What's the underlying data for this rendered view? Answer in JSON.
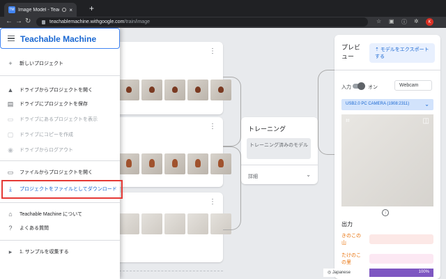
{
  "browser": {
    "tab_title": "Image Model - Teachable M",
    "tab_icon_text": "TM",
    "close_glyph": "×",
    "newtab_glyph": "+",
    "url_host": "teachablemachine.withgoogle.com",
    "url_path": "/train/image",
    "profile_initial": "K"
  },
  "drawer": {
    "brand": "Teachable Machine",
    "items": [
      {
        "label": "新しいプロジェクト",
        "icon": "plus-icon"
      },
      {
        "label": "ドライブからプロジェクトを開く",
        "icon": "drive-icon"
      },
      {
        "label": "ドライブにプロジェクトを保存",
        "icon": "save-icon"
      },
      {
        "label": "ドライブにあるプロジェクトを表示",
        "icon": "folder-icon"
      },
      {
        "label": "ドライブにコピーを作成",
        "icon": "copy-icon"
      },
      {
        "label": "ドライブからログアウト",
        "icon": "account-icon"
      },
      {
        "label": "ファイルからプロジェクトを開く",
        "icon": "folder-open-icon"
      },
      {
        "label": "プロジェクトをファイルとしてダウンロード",
        "icon": "download-icon"
      },
      {
        "label": "Teachable Machine について",
        "icon": "home-icon"
      },
      {
        "label": "よくある質問",
        "icon": "help-icon"
      },
      {
        "label": "1. サンプルを収集する",
        "icon": "play-icon"
      }
    ],
    "highlight_color": "#e53935",
    "brand_color": "#1967d2"
  },
  "training": {
    "title": "トレーニング",
    "button": "トレーニング済みのモデル",
    "details": "詳細"
  },
  "preview": {
    "title": "プレビュー",
    "export": "モデルをエクスポートする",
    "input_label": "入力",
    "on_label": "オン",
    "webcam": "Webcam",
    "camera": "USB2.0 PC CAMERA (1908:2311)",
    "output_label": "出力",
    "classes": [
      {
        "name": "きのこの山",
        "color": "#e8710a",
        "bar": "#fce8e6"
      },
      {
        "name": "たけのこの里",
        "color": "#e8710a",
        "bar": "#fce8f3"
      }
    ]
  },
  "footer": {
    "language": "Japanese",
    "zoom": "100%"
  }
}
